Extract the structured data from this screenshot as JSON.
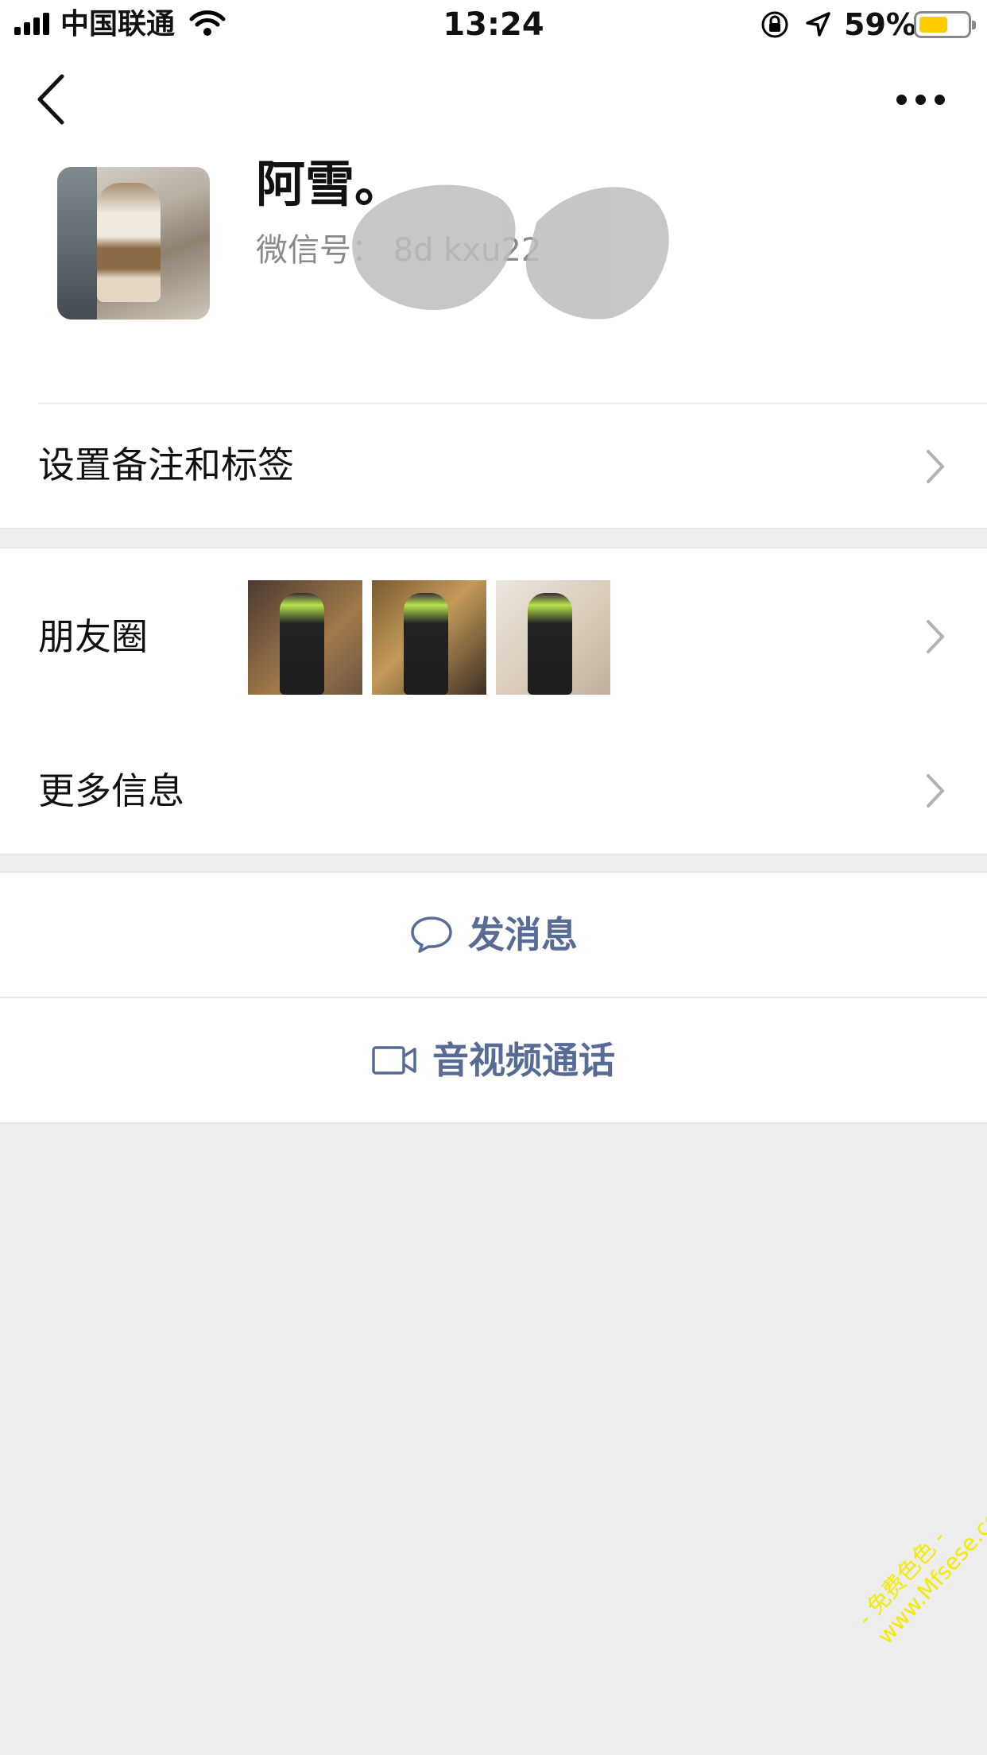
{
  "status_bar": {
    "carrier": "中国联通",
    "time": "13:24",
    "battery_percent": "59%",
    "battery_level": 0.59,
    "battery_color": "#ffcc00"
  },
  "nav": {
    "back_icon": "chevron-left-icon",
    "more_icon": "more-dots-icon"
  },
  "profile": {
    "nickname": "阿雪。",
    "wechat_id": "微信号：       8d           kxu22"
  },
  "rows": {
    "remark_tags": "设置备注和标签",
    "moments": "朋友圈",
    "more_info": "更多信息"
  },
  "actions": {
    "send_message": "发消息",
    "av_call": "音视频通话",
    "accent_color": "#576b95"
  },
  "watermark": {
    "line1": "- 免费色色 -",
    "line2": "www.Mfsese.com"
  }
}
